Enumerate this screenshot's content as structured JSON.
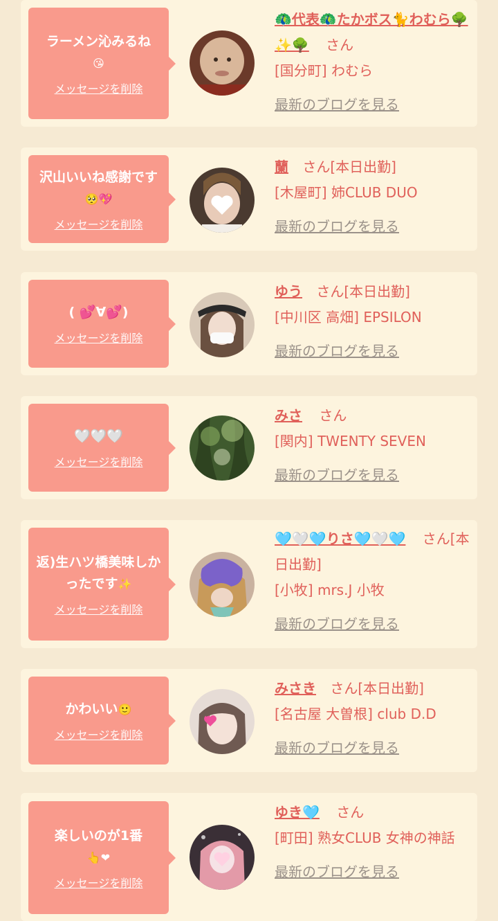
{
  "delete_label": "メッセージを削除",
  "blog_label": "最新のブログを見る",
  "san_label": "さん",
  "items": [
    {
      "message": "ラーメン沁みるね",
      "message_emoji": "😘",
      "name": "🦚代表🦚たかボス🐈わむら🌳✨🌳",
      "suffix": "",
      "shop": "[国分町] わむら",
      "avatar": "avatar-bald-man"
    },
    {
      "message": "沢山いいね感謝です",
      "message_emoji": "🥺💖",
      "name": "蘭",
      "suffix": "[本日出勤]",
      "shop": "[木屋町] 姉CLUB DUO",
      "avatar": "avatar-woman-heart-sticker"
    },
    {
      "message": "( 💕∀💕)",
      "message_emoji": "",
      "name": "ゆう",
      "suffix": "[本日出勤]",
      "shop": "[中川区 高畑] EPSILON",
      "avatar": "avatar-woman-mask"
    },
    {
      "message": "🤍🤍🤍",
      "message_emoji": "",
      "name": "みさ",
      "suffix": "",
      "shop": "[関内] TWENTY SEVEN",
      "avatar": "avatar-green-trees"
    },
    {
      "message": "返)生ハツ橋美味しかったです",
      "message_emoji": "✨",
      "name": "🩵🤍🩵りさ🩵🤍🩵",
      "suffix": "[本日出勤]",
      "shop": "[小牧] mrs.J 小牧",
      "avatar": "avatar-woman-purple-sticker"
    },
    {
      "message": "かわいい",
      "message_emoji": "🙂",
      "name": "みさき",
      "suffix": "[本日出勤]",
      "shop": "[名古屋 大曽根] club D.D",
      "avatar": "avatar-woman-heart-face"
    },
    {
      "message": "楽しいのが1番",
      "message_emoji": "👆❤",
      "name": "ゆき🩵",
      "suffix": "",
      "shop": "[町田] 熟女CLUB 女神の神話",
      "avatar": "avatar-woman-pink-hair"
    }
  ]
}
